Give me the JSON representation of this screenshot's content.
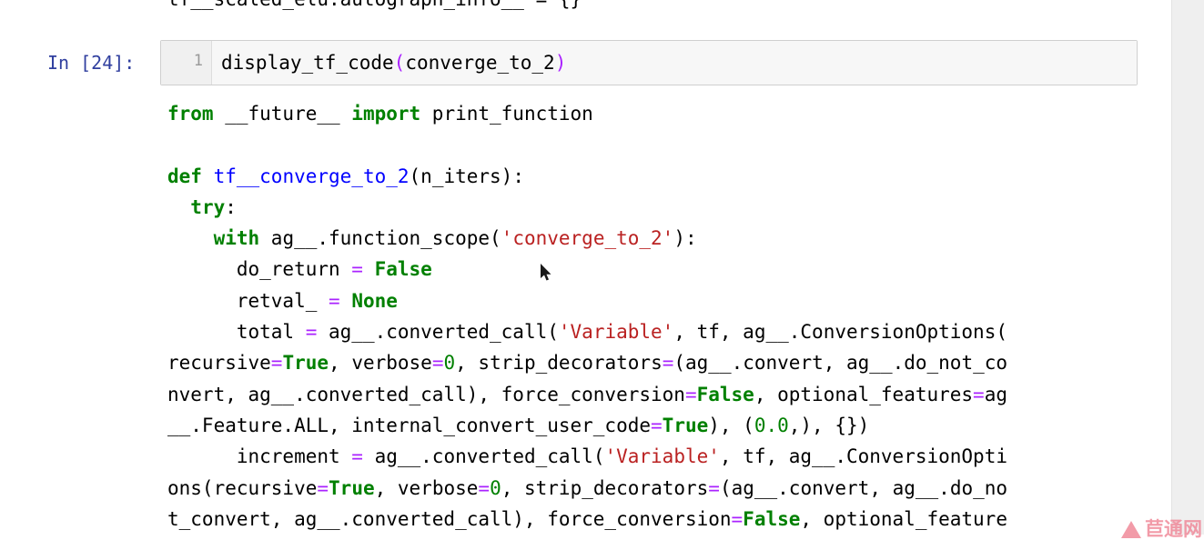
{
  "notebook": {
    "clipped_top_line": "tf__scaled_elu.autograph_info__ = {}",
    "input_cell": {
      "prompt": "In [24]:",
      "line_number": "1",
      "code_plain": "display_tf_code(converge_to_2)",
      "code_tokens": [
        {
          "t": "display_tf_code",
          "c": "plain"
        },
        {
          "t": "(",
          "c": "op"
        },
        {
          "t": "converge_to_2",
          "c": "plain"
        },
        {
          "t": ")",
          "c": "op"
        }
      ]
    },
    "output_lines": [
      {
        "tokens": [
          {
            "t": "from",
            "c": "kw"
          },
          {
            "t": " __future__ ",
            "c": "plain"
          },
          {
            "t": "import",
            "c": "kw"
          },
          {
            "t": " print_function",
            "c": "plain"
          }
        ]
      },
      {
        "tokens": []
      },
      {
        "tokens": [
          {
            "t": "def",
            "c": "kw"
          },
          {
            "t": " ",
            "c": "plain"
          },
          {
            "t": "tf__converge_to_2",
            "c": "fn"
          },
          {
            "t": "(n_iters):",
            "c": "plain"
          }
        ]
      },
      {
        "tokens": [
          {
            "t": "  ",
            "c": "plain"
          },
          {
            "t": "try",
            "c": "kw"
          },
          {
            "t": ":",
            "c": "plain"
          }
        ]
      },
      {
        "tokens": [
          {
            "t": "    ",
            "c": "plain"
          },
          {
            "t": "with",
            "c": "kw"
          },
          {
            "t": " ag__.function_scope(",
            "c": "plain"
          },
          {
            "t": "'converge_to_2'",
            "c": "str"
          },
          {
            "t": "):",
            "c": "plain"
          }
        ]
      },
      {
        "tokens": [
          {
            "t": "      do_return ",
            "c": "plain"
          },
          {
            "t": "=",
            "c": "op"
          },
          {
            "t": " ",
            "c": "plain"
          },
          {
            "t": "False",
            "c": "bi"
          }
        ]
      },
      {
        "tokens": [
          {
            "t": "      retval_ ",
            "c": "plain"
          },
          {
            "t": "=",
            "c": "op"
          },
          {
            "t": " ",
            "c": "plain"
          },
          {
            "t": "None",
            "c": "bi"
          }
        ]
      },
      {
        "tokens": [
          {
            "t": "      total ",
            "c": "plain"
          },
          {
            "t": "=",
            "c": "op"
          },
          {
            "t": " ag__.converted_call(",
            "c": "plain"
          },
          {
            "t": "'Variable'",
            "c": "str"
          },
          {
            "t": ", tf, ag__.ConversionOptions(",
            "c": "plain"
          }
        ]
      },
      {
        "tokens": [
          {
            "t": "recursive",
            "c": "plain"
          },
          {
            "t": "=",
            "c": "op"
          },
          {
            "t": "True",
            "c": "bi"
          },
          {
            "t": ", verbose",
            "c": "plain"
          },
          {
            "t": "=",
            "c": "op"
          },
          {
            "t": "0",
            "c": "num"
          },
          {
            "t": ", strip_decorators",
            "c": "plain"
          },
          {
            "t": "=",
            "c": "op"
          },
          {
            "t": "(ag__.convert, ag__.do_not_co",
            "c": "plain"
          }
        ]
      },
      {
        "tokens": [
          {
            "t": "nvert, ag__.converted_call), force_conversion",
            "c": "plain"
          },
          {
            "t": "=",
            "c": "op"
          },
          {
            "t": "False",
            "c": "bi"
          },
          {
            "t": ", optional_features",
            "c": "plain"
          },
          {
            "t": "=",
            "c": "op"
          },
          {
            "t": "ag",
            "c": "plain"
          }
        ]
      },
      {
        "tokens": [
          {
            "t": "__.Feature.ALL, internal_convert_user_code",
            "c": "plain"
          },
          {
            "t": "=",
            "c": "op"
          },
          {
            "t": "True",
            "c": "bi"
          },
          {
            "t": "), (",
            "c": "plain"
          },
          {
            "t": "0.0",
            "c": "num"
          },
          {
            "t": ",), {})",
            "c": "plain"
          }
        ]
      },
      {
        "tokens": [
          {
            "t": "      increment ",
            "c": "plain"
          },
          {
            "t": "=",
            "c": "op"
          },
          {
            "t": " ag__.converted_call(",
            "c": "plain"
          },
          {
            "t": "'Variable'",
            "c": "str"
          },
          {
            "t": ", tf, ag__.ConversionOpti",
            "c": "plain"
          }
        ]
      },
      {
        "tokens": [
          {
            "t": "ons(recursive",
            "c": "plain"
          },
          {
            "t": "=",
            "c": "op"
          },
          {
            "t": "True",
            "c": "bi"
          },
          {
            "t": ", verbose",
            "c": "plain"
          },
          {
            "t": "=",
            "c": "op"
          },
          {
            "t": "0",
            "c": "num"
          },
          {
            "t": ", strip_decorators",
            "c": "plain"
          },
          {
            "t": "=",
            "c": "op"
          },
          {
            "t": "(ag__.convert, ag__.do_no",
            "c": "plain"
          }
        ]
      },
      {
        "tokens": [
          {
            "t": "t_convert, ag__.converted_call), force_conversion",
            "c": "plain"
          },
          {
            "t": "=",
            "c": "op"
          },
          {
            "t": "False",
            "c": "bi"
          },
          {
            "t": ", optional_feature",
            "c": "plain"
          }
        ]
      }
    ]
  },
  "watermark": {
    "text": "苣通网"
  },
  "colors": {
    "keyword": "#008000",
    "function_name": "#0000ff",
    "string": "#ba2121",
    "operator": "#aa22ff",
    "number": "#008000",
    "prompt": "#303f9f",
    "cell_background": "#f7f7f7",
    "watermark": "#f08a9a"
  }
}
